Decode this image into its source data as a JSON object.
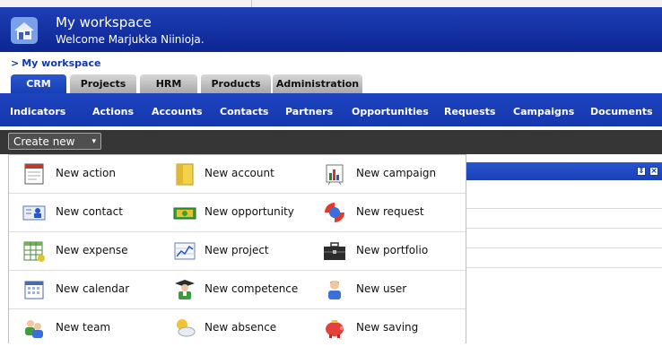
{
  "header": {
    "title": "My workspace",
    "welcome": "Welcome Marjukka Niinioja."
  },
  "breadcrumb": {
    "separator": ">",
    "label": "My workspace"
  },
  "tabs": [
    {
      "label": "CRM",
      "active": true
    },
    {
      "label": "Projects",
      "active": false
    },
    {
      "label": "HRM",
      "active": false
    },
    {
      "label": "Products",
      "active": false
    },
    {
      "label": "Administration",
      "active": false
    }
  ],
  "subnav": [
    "Indicators",
    "Actions",
    "Accounts",
    "Contacts",
    "Partners",
    "Opportunities",
    "Requests",
    "Campaigns",
    "Documents"
  ],
  "toolbar": {
    "create_label": "Create new",
    "create_caret": "▾"
  },
  "portlet": {
    "button_1": "⇕",
    "button_2": "×"
  },
  "menu": {
    "rows": [
      [
        {
          "label": "New action",
          "icon": "calendar-page-icon"
        },
        {
          "label": "New account",
          "icon": "folder-icon"
        },
        {
          "label": "New campaign",
          "icon": "bar-chart-icon"
        }
      ],
      [
        {
          "label": "New contact",
          "icon": "contact-card-icon"
        },
        {
          "label": "New opportunity",
          "icon": "money-icon"
        },
        {
          "label": "New request",
          "icon": "lifebuoy-icon"
        }
      ],
      [
        {
          "label": "New expense",
          "icon": "spreadsheet-icon"
        },
        {
          "label": "New project",
          "icon": "line-chart-icon"
        },
        {
          "label": "New portfolio",
          "icon": "briefcase-icon"
        }
      ],
      [
        {
          "label": "New calendar",
          "icon": "calendar-grid-icon"
        },
        {
          "label": "New competence",
          "icon": "graduate-icon"
        },
        {
          "label": "New user",
          "icon": "user-icon"
        }
      ],
      [
        {
          "label": "New team",
          "icon": "team-icon"
        },
        {
          "label": "New absence",
          "icon": "weather-icon"
        },
        {
          "label": "New saving",
          "icon": "piggy-bank-icon"
        }
      ]
    ]
  }
}
